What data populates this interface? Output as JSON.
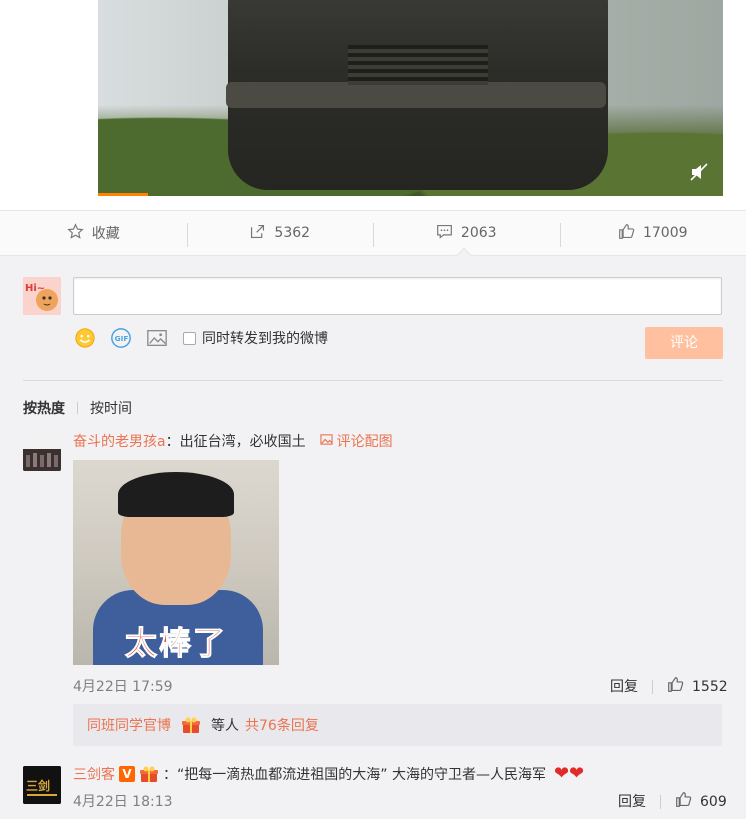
{
  "post": {
    "actions": {
      "favorite": "收藏",
      "repost": "5362",
      "comment": "2063",
      "like": "17009"
    }
  },
  "composer": {
    "repost_label": "同时转发到我的微博",
    "submit_label": "评论"
  },
  "sort": {
    "hot": "按热度",
    "time": "按时间"
  },
  "comments": [
    {
      "user": "奋斗的老男孩a",
      "text": "：出征台湾，必收国土",
      "pic_link": "评论配图",
      "image_caption": "太棒了",
      "time": "4月22日 17:59",
      "reply_label": "回复",
      "likes": "1552",
      "sub": {
        "user": "同班同学官博",
        "middle": "等人",
        "count": "共76条回复"
      }
    },
    {
      "user": "三剑客",
      "text": "：“把每一滴热血都流进祖国的大海”  大海的守卫者—人民海军",
      "time": "4月22日 18:13",
      "reply_label": "回复",
      "likes": "609",
      "verified_badge": "V",
      "hearts": "❤❤"
    }
  ],
  "colors": {
    "accent": "#eb7350",
    "submit_bg": "#ffc09f",
    "page_bg": "#f2f2f5"
  }
}
